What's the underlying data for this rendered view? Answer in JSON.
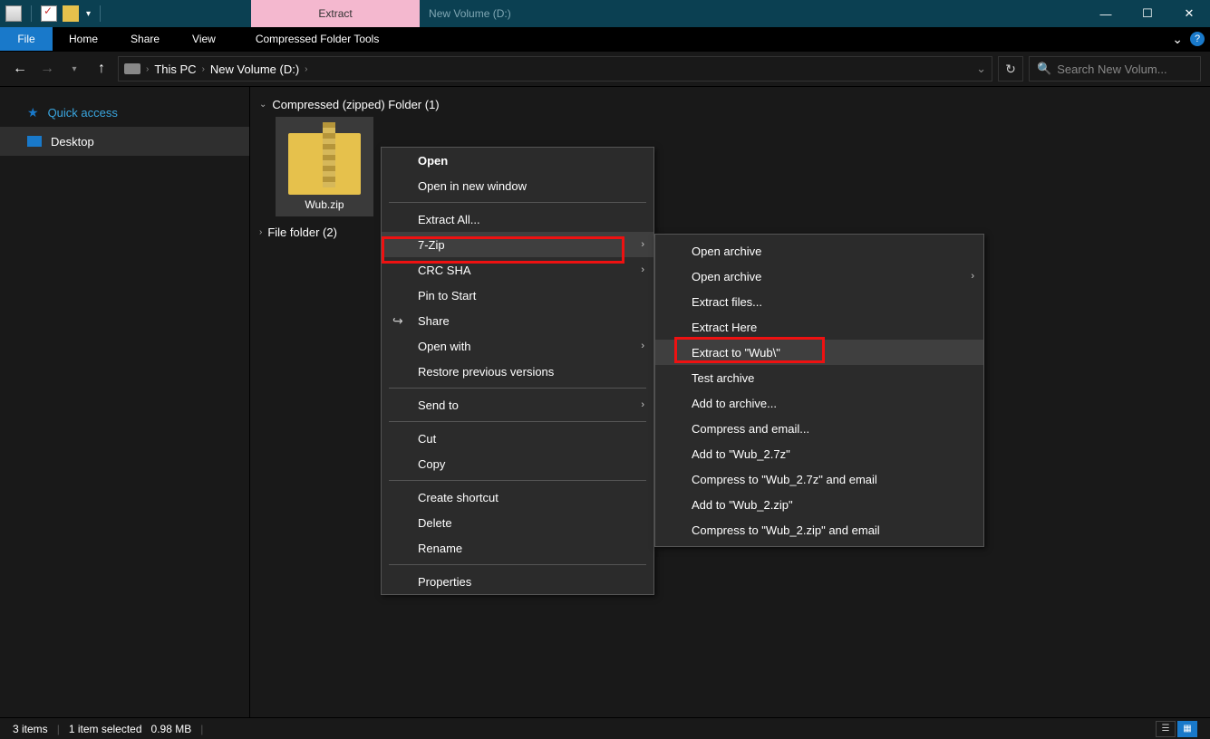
{
  "titlebar": {
    "extract_label": "Extract",
    "window_title": "New Volume (D:)"
  },
  "ribbon": {
    "file": "File",
    "tabs": [
      "Home",
      "Share",
      "View"
    ],
    "tools_tab": "Compressed Folder Tools"
  },
  "breadcrumb": {
    "root": "This PC",
    "current": "New Volume (D:)"
  },
  "search": {
    "placeholder": "Search New Volum..."
  },
  "sidebar": {
    "quick_access": "Quick access",
    "desktop": "Desktop"
  },
  "content": {
    "group1": "Compressed (zipped) Folder (1)",
    "file_name": "Wub.zip",
    "group2": "File folder (2)"
  },
  "context_menu": {
    "open": "Open",
    "open_new_window": "Open in new window",
    "extract_all": "Extract All...",
    "seven_zip": "7-Zip",
    "crc_sha": "CRC SHA",
    "pin_to_start": "Pin to Start",
    "share": "Share",
    "open_with": "Open with",
    "restore_prev": "Restore previous versions",
    "send_to": "Send to",
    "cut": "Cut",
    "copy": "Copy",
    "create_shortcut": "Create shortcut",
    "delete": "Delete",
    "rename": "Rename",
    "properties": "Properties"
  },
  "submenu": {
    "open_archive1": "Open archive",
    "open_archive2": "Open archive",
    "extract_files": "Extract files...",
    "extract_here": "Extract Here",
    "extract_to": "Extract to \"Wub\\\"",
    "test_archive": "Test archive",
    "add_to_archive": "Add to archive...",
    "compress_email": "Compress and email...",
    "add_to_7z": "Add to \"Wub_2.7z\"",
    "compress_7z_email": "Compress to \"Wub_2.7z\" and email",
    "add_to_zip": "Add to \"Wub_2.zip\"",
    "compress_zip_email": "Compress to \"Wub_2.zip\" and email"
  },
  "status": {
    "items": "3 items",
    "selected": "1 item selected",
    "size": "0.98 MB"
  }
}
